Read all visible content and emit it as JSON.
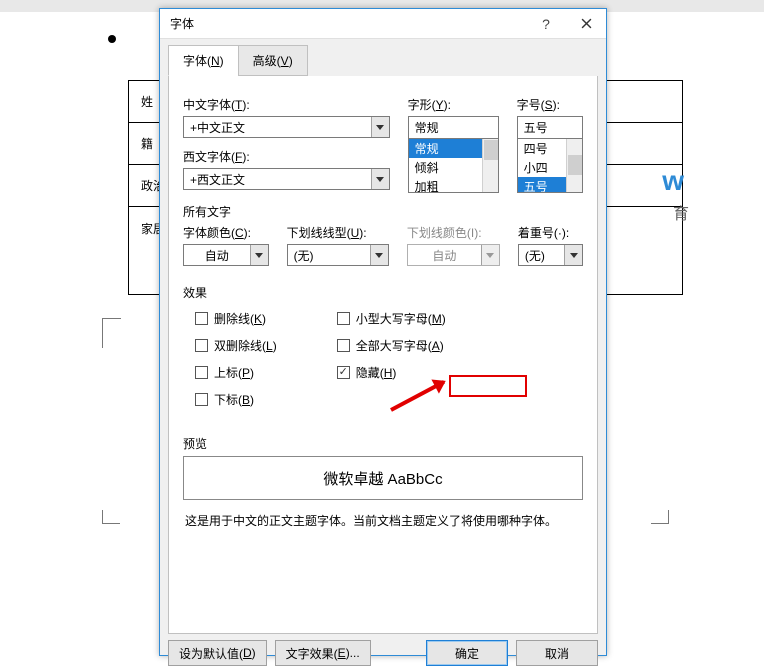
{
  "dialog": {
    "title": "字体",
    "help_label": "?",
    "tabs": {
      "font": {
        "text": "字体(",
        "accel": "N",
        "suffix": ")"
      },
      "advanced": {
        "text": "高级(",
        "accel": "V",
        "suffix": ")"
      }
    },
    "cn_font": {
      "label": "中文字体(",
      "accel": "T",
      "suffix": "):",
      "value": "+中文正文"
    },
    "latin_font": {
      "label": "西文字体(",
      "accel": "F",
      "suffix": "):",
      "value": "+西文正文"
    },
    "style": {
      "label": "字形(",
      "accel": "Y",
      "suffix": "):",
      "value": "常规",
      "options": [
        "常规",
        "倾斜",
        "加粗"
      ]
    },
    "size": {
      "label": "字号(",
      "accel": "S",
      "suffix": "):",
      "value": "五号",
      "options": [
        "四号",
        "小四",
        "五号"
      ]
    },
    "all_text_label": "所有文字",
    "font_color": {
      "label": "字体颜色(",
      "accel": "C",
      "suffix": "):",
      "value": "自动"
    },
    "underline_style": {
      "label": "下划线线型(",
      "accel": "U",
      "suffix": "):",
      "value": "(无)"
    },
    "underline_color": {
      "label": "下划线颜色(I):",
      "value": "自动"
    },
    "emphasis": {
      "label": "着重号(·):",
      "value": "(无)"
    },
    "effects_label": "效果",
    "effects": {
      "strike": {
        "text": "删除线(",
        "accel": "K",
        "suffix": ")",
        "checked": false
      },
      "dstrike": {
        "text": "双删除线(",
        "accel": "L",
        "suffix": ")",
        "checked": false
      },
      "sup": {
        "text": "上标(",
        "accel": "P",
        "suffix": ")",
        "checked": false
      },
      "sub": {
        "text": "下标(",
        "accel": "B",
        "suffix": ")",
        "checked": false
      },
      "smallcaps": {
        "text": "小型大写字母(",
        "accel": "M",
        "suffix": ")",
        "checked": false
      },
      "allcaps": {
        "text": "全部大写字母(",
        "accel": "A",
        "suffix": ")",
        "checked": false
      },
      "hidden": {
        "text": "隐藏(",
        "accel": "H",
        "suffix": ")",
        "checked": true
      }
    },
    "preview_label": "预览",
    "preview_text": "微软卓越 AaBbCc",
    "hint": "这是用于中文的正文主题字体。当前文档主题定义了将使用哪种字体。",
    "buttons": {
      "default": {
        "text": "设为默认值(",
        "accel": "D",
        "suffix": ")"
      },
      "texteffects": {
        "text": "文字效果(",
        "accel": "E",
        "suffix": ")..."
      },
      "ok": "确定",
      "cancel": "取消"
    }
  },
  "background": {
    "rows": [
      "姓",
      "籍",
      "政治",
      "家居"
    ],
    "edu1": "w",
    "edu2": "育"
  }
}
